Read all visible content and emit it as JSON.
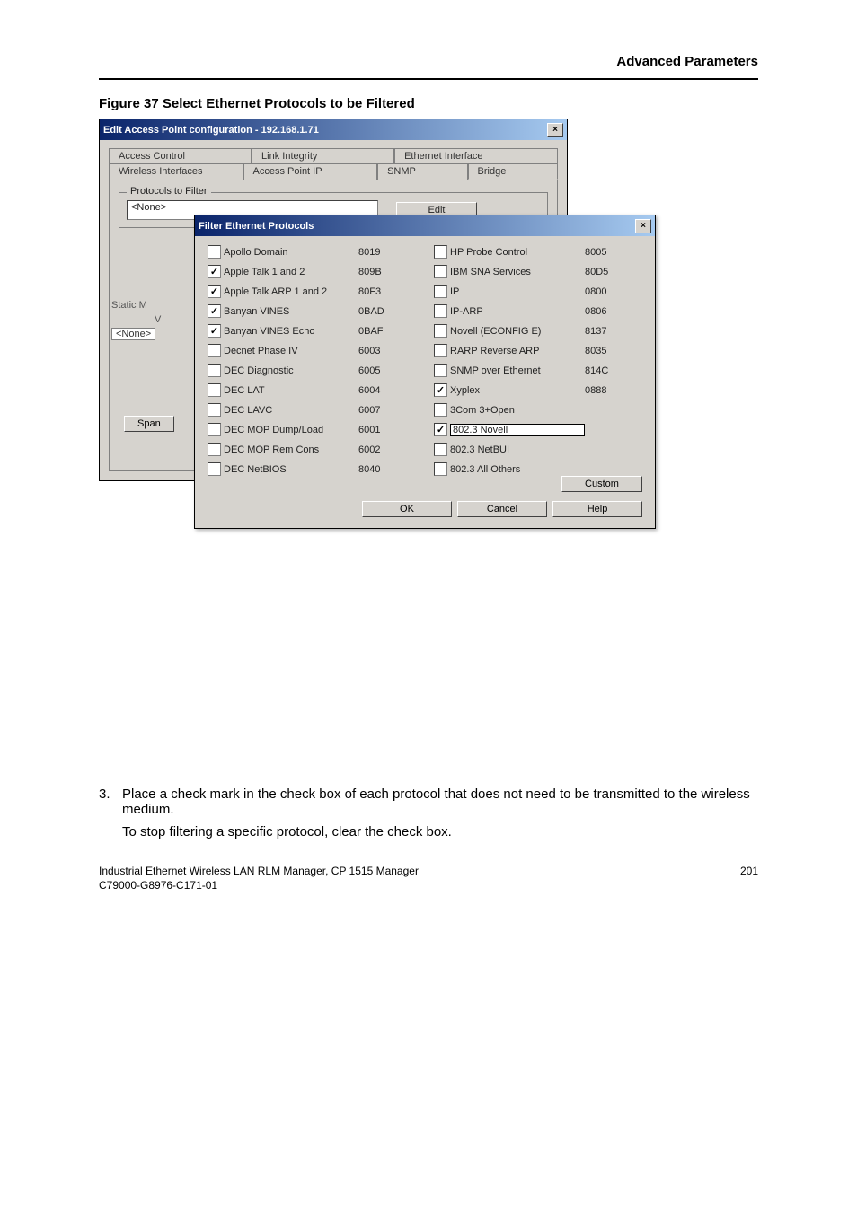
{
  "header": {
    "section_title": "Advanced Parameters"
  },
  "figure": {
    "caption": "Figure 37   Select Ethernet Protocols to be Filtered"
  },
  "outer_dialog": {
    "title": "Edit Access Point configuration - 192.168.1.71",
    "tabs_row1": [
      "Access Control",
      "Link Integrity",
      "Ethernet Interface"
    ],
    "tabs_row2": [
      "Wireless Interfaces",
      "Access Point IP",
      "SNMP",
      "Bridge"
    ],
    "group_label": "Protocols to Filter",
    "text_value": "<None>",
    "edit_btn": "Edit",
    "left_partial1": "Static M",
    "left_partial2": "V",
    "left_partial3": "<None>",
    "left_partial4": "Span"
  },
  "inner_dialog": {
    "title": "Filter Ethernet Protocols",
    "custom_btn": "Custom",
    "ok_btn": "OK",
    "cancel_btn": "Cancel",
    "help_btn": "Help",
    "protocols_left": [
      {
        "label": "Apollo Domain",
        "code": "8019",
        "checked": false
      },
      {
        "label": "Apple Talk 1 and 2",
        "code": "809B",
        "checked": true
      },
      {
        "label": "Apple Talk ARP 1 and 2",
        "code": "80F3",
        "checked": true
      },
      {
        "label": "Banyan VINES",
        "code": "0BAD",
        "checked": true
      },
      {
        "label": "Banyan VINES Echo",
        "code": "0BAF",
        "checked": true
      },
      {
        "label": "Decnet Phase IV",
        "code": "6003",
        "checked": false
      },
      {
        "label": "DEC Diagnostic",
        "code": "6005",
        "checked": false
      },
      {
        "label": "DEC LAT",
        "code": "6004",
        "checked": false
      },
      {
        "label": "DEC LAVC",
        "code": "6007",
        "checked": false
      },
      {
        "label": "DEC MOP Dump/Load",
        "code": "6001",
        "checked": false
      },
      {
        "label": "DEC MOP Rem Cons",
        "code": "6002",
        "checked": false
      },
      {
        "label": "DEC NetBIOS",
        "code": "8040",
        "checked": false
      }
    ],
    "protocols_right": [
      {
        "label": "HP Probe Control",
        "code": "8005",
        "checked": false
      },
      {
        "label": "IBM SNA Services",
        "code": "80D5",
        "checked": false
      },
      {
        "label": "IP",
        "code": "0800",
        "checked": false
      },
      {
        "label": "IP-ARP",
        "code": "0806",
        "checked": false
      },
      {
        "label": "Novell (ECONFIG E)",
        "code": "8137",
        "checked": false
      },
      {
        "label": "RARP Reverse ARP",
        "code": "8035",
        "checked": false
      },
      {
        "label": "SNMP over Ethernet",
        "code": "814C",
        "checked": false
      },
      {
        "label": "Xyplex",
        "code": "0888",
        "checked": true
      },
      {
        "label": "3Com 3+Open",
        "code": "",
        "checked": false
      },
      {
        "label": "802.3 Novell",
        "code": "",
        "checked": true,
        "highlight": true
      },
      {
        "label": "802.3 NetBUI",
        "code": "",
        "checked": false
      },
      {
        "label": "802.3 All Others",
        "code": "",
        "checked": false
      }
    ]
  },
  "step": {
    "number": "3.",
    "text": "Place a check mark in the check box of each protocol that does not need to be transmitted to the wireless medium.",
    "note": "To stop filtering a specific protocol, clear the check box."
  },
  "footer": {
    "line1": "Industrial Ethernet Wireless LAN  RLM Manager,  CP 1515 Manager",
    "line2": "C79000-G8976-C171-01",
    "page": "201"
  }
}
